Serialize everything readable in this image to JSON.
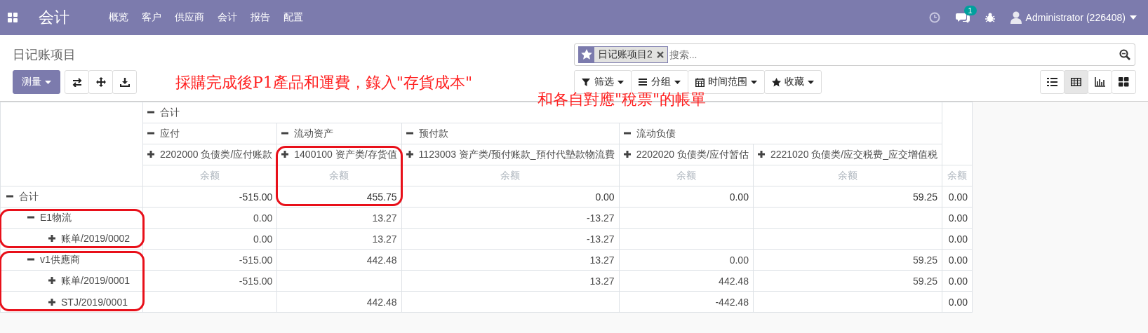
{
  "navbar": {
    "app": "会计",
    "menu": [
      "概览",
      "客户",
      "供应商",
      "会计",
      "报告",
      "配置"
    ],
    "messages_badge": "1",
    "user": "Administrator (226408)"
  },
  "control_panel": {
    "title": "日记账项目",
    "search": {
      "facets": [
        {
          "label": "日记账项目2"
        }
      ],
      "placeholder": "搜索..."
    },
    "measure_button": "测量",
    "filter_buttons": [
      {
        "kind": "filter",
        "label": "筛选"
      },
      {
        "kind": "group",
        "label": "分组"
      },
      {
        "kind": "date",
        "label": "时间范围"
      },
      {
        "kind": "favorite",
        "label": "收藏"
      }
    ],
    "views": [
      {
        "kind": "list",
        "selected": false
      },
      {
        "kind": "pivot",
        "selected": true
      },
      {
        "kind": "graph",
        "selected": false
      },
      {
        "kind": "kanban",
        "selected": false
      }
    ]
  },
  "pivot": {
    "columns": [
      {
        "label": "合计",
        "expanded": true,
        "children": [
          {
            "label": "应付",
            "expanded": true,
            "children": [
              {
                "label": "2202000 负债类/应付账款",
                "expanded": false
              }
            ]
          },
          {
            "label": "流动资产",
            "expanded": true,
            "children": [
              {
                "label": "1400100 资产类/存货值",
                "expanded": false,
                "circled": true
              }
            ]
          },
          {
            "label": "预付款",
            "expanded": true,
            "children": [
              {
                "label": "1123003 资产类/预付账款_預付代墊款物流費",
                "expanded": false
              }
            ]
          },
          {
            "label": "流动负债",
            "expanded": true,
            "children": [
              {
                "label": "2202020 负债类/应付暂估",
                "expanded": false
              },
              {
                "label": "2221020 负债类/应交税费_应交增值税",
                "expanded": false
              }
            ]
          }
        ]
      }
    ],
    "measures": [
      "余额",
      "余额",
      "余额",
      "余额",
      "余额",
      "余额"
    ],
    "rows": [
      {
        "label": "合计",
        "expanded": true,
        "values": {
          "col_1": "-515.00",
          "col_2": "455.75",
          "col_3": "0.00",
          "col_4": "0.00",
          "col_5": "59.25"
        },
        "total": "0.00",
        "children": [
          {
            "label": "E1物流",
            "expanded": true,
            "circled": true,
            "values": {
              "col_1": "0.00",
              "col_2": "13.27",
              "col_3": "-13.27"
            },
            "total": "0.00",
            "children": [
              {
                "label": "账单/2019/0002",
                "expanded": false,
                "values": {
                  "col_1": "0.00",
                  "col_2": "13.27",
                  "col_3": "-13.27"
                },
                "total": "0.00"
              }
            ]
          },
          {
            "label": "v1供應商",
            "expanded": true,
            "circled": true,
            "values": {
              "col_1": "-515.00",
              "col_2": "442.48",
              "col_3": "13.27",
              "col_4": "0.00",
              "col_5": "59.25"
            },
            "total": "0.00",
            "children": [
              {
                "label": "账单/2019/0001",
                "expanded": false,
                "values": {
                  "col_1": "-515.00",
                  "col_3": "13.27",
                  "col_4": "442.48",
                  "col_5": "59.25"
                },
                "total": "0.00"
              },
              {
                "label": "STJ/2019/0001",
                "expanded": false,
                "values": {
                  "col_2": "442.48",
                  "col_4": "-442.48"
                },
                "total": "0.00"
              }
            ]
          }
        ]
      }
    ]
  },
  "annotations": [
    {
      "text": "採購完成後P1產品和運費，錄入\"存貨成本\""
    },
    {
      "text": "和各自對應\"稅票\"的帳單"
    }
  ]
}
